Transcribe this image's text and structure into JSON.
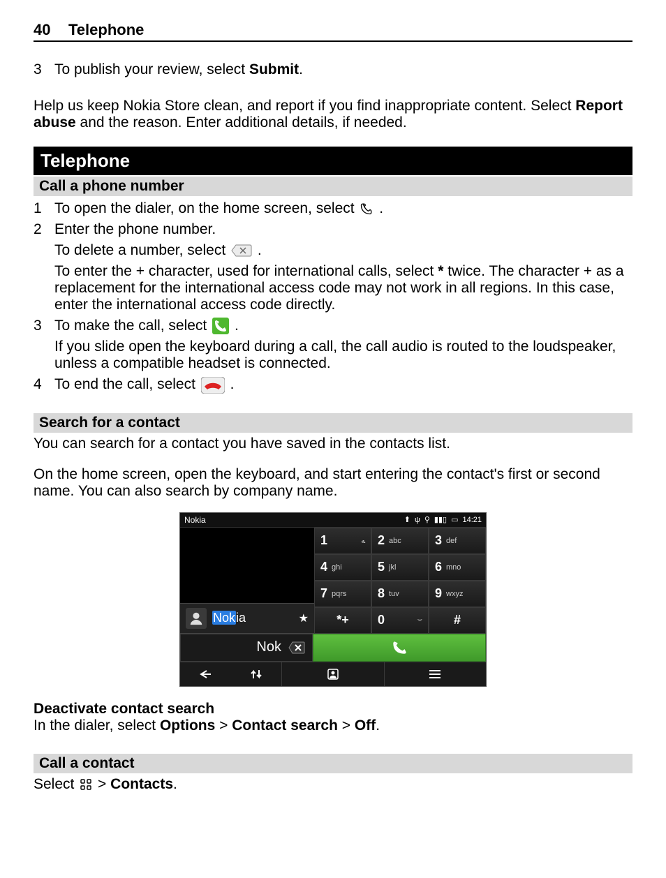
{
  "header": {
    "page_number": "40",
    "section": "Telephone"
  },
  "intro": {
    "step3_num": "3",
    "step3_a": "To publish your review, select ",
    "step3_bold": "Submit",
    "step3_b": ".",
    "help_a": "Help us keep Nokia Store clean, and report if you find inappropriate content. Select ",
    "help_bold": "Report abuse",
    "help_b": " and the reason. Enter additional details, if needed."
  },
  "section_black": "Telephone",
  "call_number": {
    "title": "Call a phone number",
    "steps": {
      "s1": {
        "n": "1",
        "a": "To open the dialer, on the home screen, select ",
        "b": "."
      },
      "s2": {
        "n": "2",
        "line1": "Enter the phone number.",
        "line2a": "To delete a number, select ",
        "line2b": " .",
        "line3a": "To enter the + character, used for international calls, select ",
        "line3bold": "*",
        "line3b": " twice. The character + as a replacement for the international access code may not work in all regions. In this case, enter the international access code directly."
      },
      "s3": {
        "n": "3",
        "a": "To make the call, select ",
        "b": " .",
        "line2": "If you slide open the keyboard during a call, the call audio is routed to the loudspeaker, unless a compatible headset is connected."
      },
      "s4": {
        "n": "4",
        "a": "To end the call, select ",
        "b": " ."
      }
    }
  },
  "search_contact": {
    "title": "Search for a contact",
    "p1": "You can search for a contact you have saved in the contacts list.",
    "p2": "On the home screen, open the keyboard, and start entering the contact's first or second name. You can also search by company name."
  },
  "phone": {
    "status_label": "Nokia",
    "status_time": "14:21",
    "contact_highlight": "Nok",
    "contact_rest": "ia",
    "typed": "Nok",
    "keys": [
      {
        "n": "1",
        "l": "ﻪ"
      },
      {
        "n": "2",
        "l": "abc"
      },
      {
        "n": "3",
        "l": "def"
      },
      {
        "n": "4",
        "l": "ghi"
      },
      {
        "n": "5",
        "l": "jkl"
      },
      {
        "n": "6",
        "l": "mno"
      },
      {
        "n": "7",
        "l": "pqrs"
      },
      {
        "n": "8",
        "l": "tuv"
      },
      {
        "n": "9",
        "l": "wxyz"
      },
      {
        "n": "*+",
        "l": ""
      },
      {
        "n": "0",
        "l": "⌣"
      },
      {
        "n": "#",
        "l": ""
      }
    ]
  },
  "deactivate": {
    "title": "Deactivate contact search",
    "a": "In the dialer, select ",
    "b1": "Options",
    "sep1": " > ",
    "b2": "Contact search",
    "sep2": " > ",
    "b3": "Off",
    "c": "."
  },
  "call_contact": {
    "title": "Call a contact",
    "a": "Select ",
    "sep": " > ",
    "b": "Contacts",
    "c": "."
  }
}
